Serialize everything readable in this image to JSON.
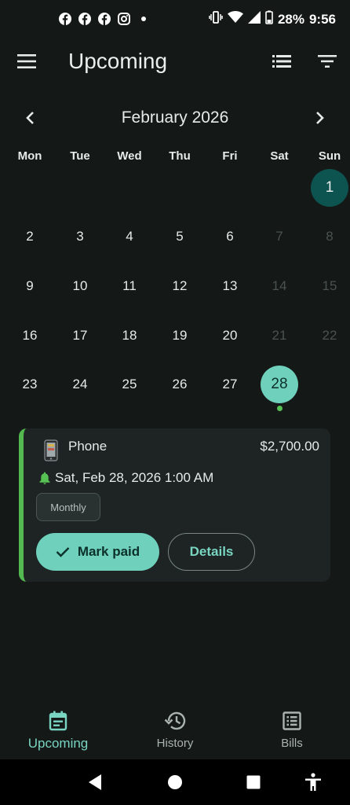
{
  "status_bar": {
    "notification_icons": [
      "facebook-icon",
      "facebook-icon",
      "facebook-icon",
      "instagram-icon",
      "dot-icon"
    ],
    "battery": "28%",
    "time": "9:56"
  },
  "app_bar": {
    "title": "Upcoming"
  },
  "calendar": {
    "month_label": "February 2026",
    "weekdays": [
      "Mon",
      "Tue",
      "Wed",
      "Thu",
      "Fri",
      "Sat",
      "Sun"
    ],
    "weeks": [
      [
        "",
        "",
        "",
        "",
        "",
        "",
        "1"
      ],
      [
        "2",
        "3",
        "4",
        "5",
        "6",
        "7",
        "8"
      ],
      [
        "9",
        "10",
        "11",
        "12",
        "13",
        "14",
        "15"
      ],
      [
        "16",
        "17",
        "18",
        "19",
        "20",
        "21",
        "22"
      ],
      [
        "23",
        "24",
        "25",
        "26",
        "27",
        "28",
        ""
      ]
    ],
    "today": "1",
    "selected": "28",
    "dimmed": [
      "7",
      "8",
      "14",
      "15",
      "21",
      "22"
    ],
    "bill_marker_day": "28",
    "colors": {
      "today_bg": "#0d5450",
      "selected_bg": "#6fd0bc",
      "marker": "#57c254"
    }
  },
  "bill": {
    "name": "Phone",
    "amount": "$2,700.00",
    "due": "Sat, Feb 28, 2026 1:00 AM",
    "frequency": "Monthly",
    "mark_paid_label": "Mark paid",
    "details_label": "Details",
    "accent_color": "#52b84f"
  },
  "bottom_nav": {
    "items": [
      {
        "label": "Upcoming",
        "icon": "calendar-icon",
        "active": true
      },
      {
        "label": "History",
        "icon": "history-icon",
        "active": false
      },
      {
        "label": "Bills",
        "icon": "list-icon",
        "active": false
      }
    ]
  }
}
